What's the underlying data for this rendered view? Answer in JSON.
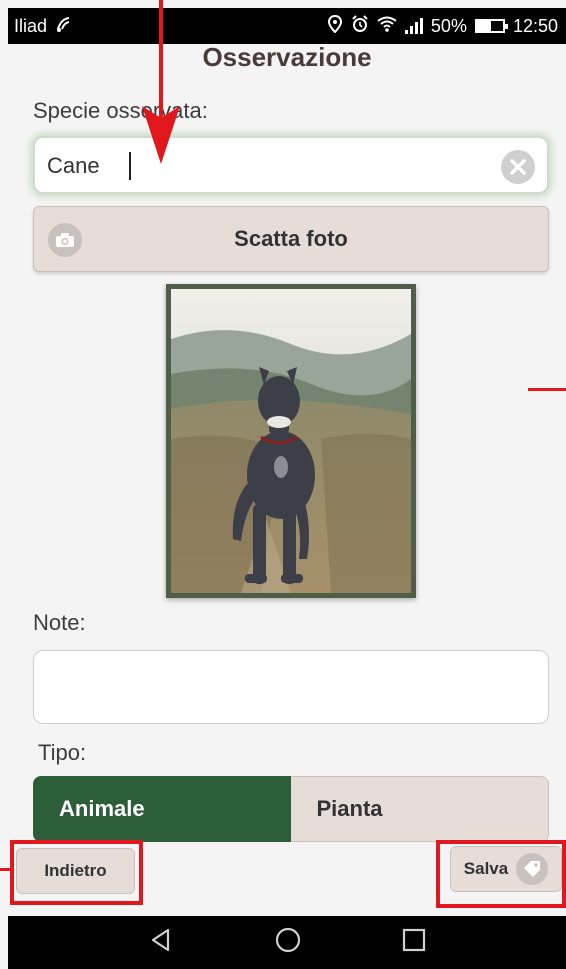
{
  "status_bar": {
    "carrier": "Iliad",
    "battery_percent": "50%",
    "time": "12:50"
  },
  "page": {
    "title": "Osservazione",
    "species_label": "Specie osservata:",
    "species_value": "Cane",
    "photo_button_label": "Scatta foto",
    "notes_label": "Note:",
    "notes_value": "",
    "type_label": "Tipo:",
    "type_options": [
      "Animale",
      "Pianta"
    ],
    "type_selected": "Animale"
  },
  "footer": {
    "back_label": "Indietro",
    "save_label": "Salva"
  },
  "colors": {
    "accent_green": "#2d5e3a",
    "button_beige": "#e6ddd8",
    "annotation_red": "#e0171c"
  },
  "icons": [
    "wifi-calling-icon",
    "location-icon",
    "alarm-icon",
    "wifi-icon",
    "signal-icon",
    "battery-icon",
    "clear-icon",
    "camera-icon",
    "tag-icon",
    "nav-back-icon",
    "nav-home-icon",
    "nav-recents-icon"
  ]
}
